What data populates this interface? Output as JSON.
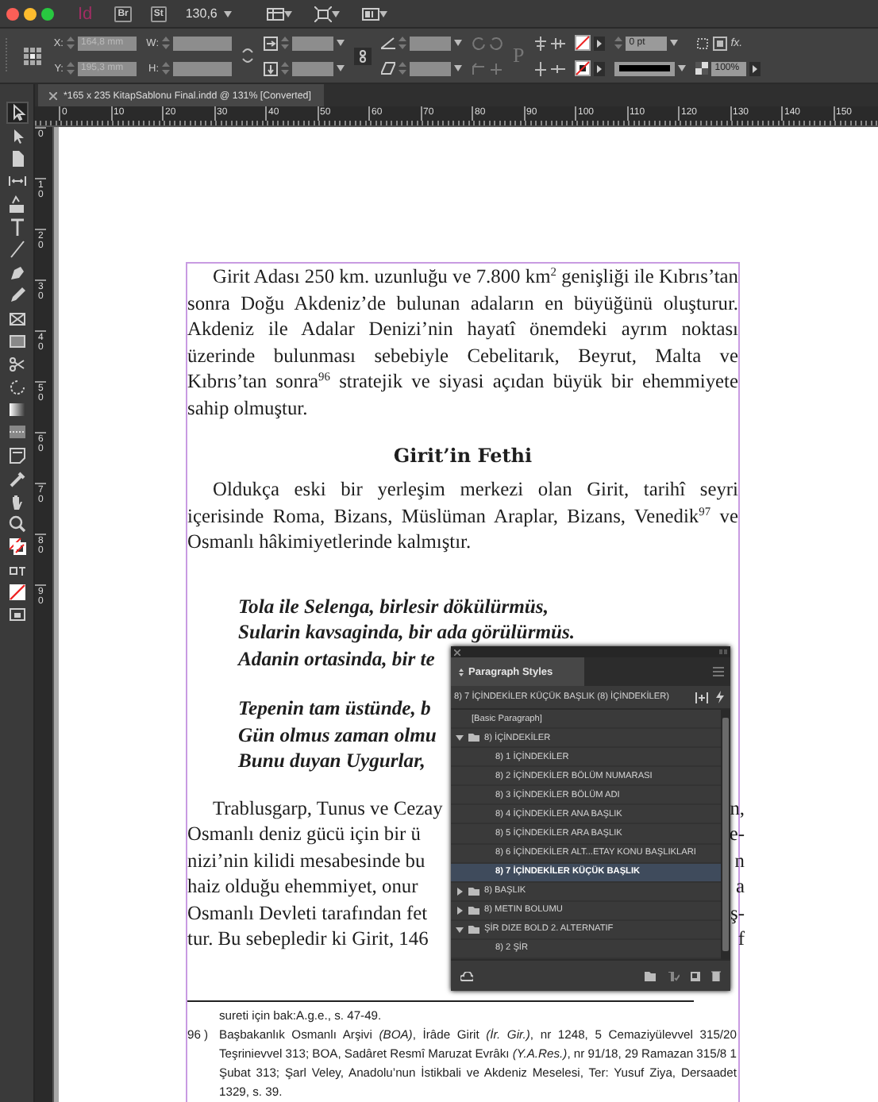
{
  "app": {
    "logo": "Id",
    "bridge_button": "Br",
    "stock_button": "St",
    "zoom": "130,6"
  },
  "control_panel": {
    "x_label": "X:",
    "x_value": "164,8 mm",
    "y_label": "Y:",
    "y_value": "195,3 mm",
    "w_label": "W:",
    "h_label": "H:",
    "frame_glyph": "P",
    "stroke_weight": "0 pt",
    "effects_button": "fx.",
    "opacity": "100%"
  },
  "document_tab": {
    "title": "*165 x 235 KitapSablonu Final.indd @ 131% [Converted]"
  },
  "horizontal_ruler": [
    "0",
    "10",
    "20",
    "30",
    "40",
    "50",
    "60",
    "70",
    "80",
    "90",
    "100",
    "110",
    "120",
    "130",
    "140",
    "150"
  ],
  "vertical_ruler": [
    "0",
    "10",
    "20",
    "30",
    "40",
    "50",
    "60",
    "70",
    "80",
    "90"
  ],
  "tools": [
    {
      "kind": "selection",
      "selected": true
    },
    {
      "kind": "direct_selection",
      "selected": false
    },
    {
      "kind": "page",
      "selected": false
    },
    {
      "kind": "gap",
      "selected": false
    },
    {
      "kind": "collector",
      "selected": false
    },
    {
      "kind": "type",
      "selected": false
    },
    {
      "kind": "line",
      "selected": false
    },
    {
      "kind": "pen",
      "selected": false
    },
    {
      "kind": "pencil",
      "selected": false
    },
    {
      "kind": "frame",
      "selected": false
    },
    {
      "kind": "rectangle",
      "selected": false
    },
    {
      "kind": "scissors",
      "selected": false
    },
    {
      "kind": "transform",
      "selected": false
    },
    {
      "kind": "gradient",
      "selected": false
    },
    {
      "kind": "feather",
      "selected": false
    },
    {
      "kind": "note",
      "selected": false
    },
    {
      "kind": "eyedropper",
      "selected": false
    },
    {
      "kind": "hand",
      "selected": false
    },
    {
      "kind": "zoom",
      "selected": false
    },
    {
      "kind": "fill_stroke",
      "selected": false
    },
    {
      "kind": "formatting",
      "selected": false
    },
    {
      "kind": "none_swatch",
      "selected": false
    },
    {
      "kind": "screen_mode",
      "selected": false
    }
  ],
  "document": {
    "body": [
      {
        "kind": "paragraph",
        "text": "Girit Adası 250 km. uzunluğu ve 7.800 km$^{2}$ genişliği ile Kıbrıs’tan sonra Doğu Akdeniz’de bulunan adaların en büyüğünü oluşturur. Akdeniz ile Adalar Denizi’nin hayatî önemdeki ayrım noktası üzerinde bulunması sebebiyle Cebelitarık, Beyrut, Malta ve Kıbrıs’tan sonra$^{96}$ stratejik ve siyasi açıdan büyük bir ehemmiyete sahip olmuştur."
      },
      {
        "kind": "heading",
        "text": "Girit’in Fethi"
      },
      {
        "kind": "paragraph",
        "text": "Oldukça eski bir yerleşim merkezi olan Girit, tarihî seyri içerisinde Roma, Bizans, Müslüman Araplar, Bizans, Venedik$^{97}$ ve Osmanlı hâkimiyetlerinde kalmıştır."
      },
      {
        "kind": "verse",
        "stanzas": [
          [
            "Tola ile Selenga, birlesir dökülürmüs,",
            "Sularin kavsaginda, bir ada görülürmüs.",
            "Adanin ortasinda, bir te"
          ],
          [
            "Tepenin tam üstünde, b",
            "Gün olmus zaman olmu",
            "Bunu duyan Uygurlar,"
          ]
        ]
      },
      {
        "kind": "covered_paragraph",
        "lines": [
          {
            "left": "Trablusgarp, Tunus ve Cezay",
            "right": "n,"
          },
          {
            "left": "Osmanlı deniz gücü için bir ü",
            "right": "e-"
          },
          {
            "left": "nizi’nin kilidi mesabesinde bu",
            "right": "n"
          },
          {
            "left": "haiz olduğu ehemmiyet, onur",
            "right": "a"
          },
          {
            "left": "Osmanlı Devleti tarafından fet",
            "right": "ş-"
          },
          {
            "left": "tur. Bu sebepledir ki Girit, 146",
            "right": "f"
          }
        ]
      }
    ],
    "footnotes": [
      {
        "text": "sureti için bak:A.g.e., s. 47-49."
      },
      {
        "number": "96 )",
        "text": "Başbakanlık Osmanlı Arşivi *(BOA)*, İrâde Girit *(İr. Gir.)*, nr 1248, 5 Cemaziyülevvel 315/20 Teşrinievvel 313; BOA, Sadâret Resmî Maruzat Evrâkı *(Y.A.Res.)*, nr 91/18, 29 Ramazan 315/8 1 Şubat 313; Şarl Veley, Anadolu’nun İstikbali ve Akdeniz Meselesi, Ter: Yusuf Ziya, Dersaadet 1329, s. 39."
      }
    ]
  },
  "paragraph_styles_panel": {
    "title": "Paragraph Styles",
    "current_style": "8) 7 İÇİNDEKİLER KÜÇÜK BAŞLIK (8) İÇİNDEKİLER)",
    "styles": [
      {
        "kind": "style",
        "label": "[Basic Paragraph]",
        "selected": false
      },
      {
        "kind": "group",
        "label": "8) İÇİNDEKİLER",
        "expanded": true,
        "children": [
          {
            "kind": "style",
            "label": "8) 1 İÇİNDEKİLER",
            "selected": false
          },
          {
            "kind": "style",
            "label": "8) 2 İÇİNDEKİLER BÖLÜM NUMARASI",
            "selected": false
          },
          {
            "kind": "style",
            "label": "8) 3 İÇİNDEKİLER BÖLÜM ADI",
            "selected": false
          },
          {
            "kind": "style",
            "label": "8) 4 İÇİNDEKİLER ANA BAŞLIK",
            "selected": false
          },
          {
            "kind": "style",
            "label": "8) 5 İÇİNDEKİLER ARA BAŞLIK",
            "selected": false
          },
          {
            "kind": "style",
            "label": "8) 6 İÇİNDEKİLER ALT...ETAY KONU BAŞLIKLARI",
            "selected": false
          },
          {
            "kind": "style",
            "label": "8) 7 İÇİNDEKİLER KÜÇÜK BAŞLIK",
            "selected": true
          }
        ]
      },
      {
        "kind": "group",
        "label": "8) BAŞLIK",
        "expanded": false
      },
      {
        "kind": "group",
        "label": "8) METIN BOLUMU",
        "expanded": false
      },
      {
        "kind": "group",
        "label": "ŞİR DIZE BOLD  2. ALTERNATIF",
        "expanded": true,
        "children": [
          {
            "kind": "style",
            "label": "8) 2 ŞİR",
            "selected": false
          }
        ]
      }
    ]
  }
}
